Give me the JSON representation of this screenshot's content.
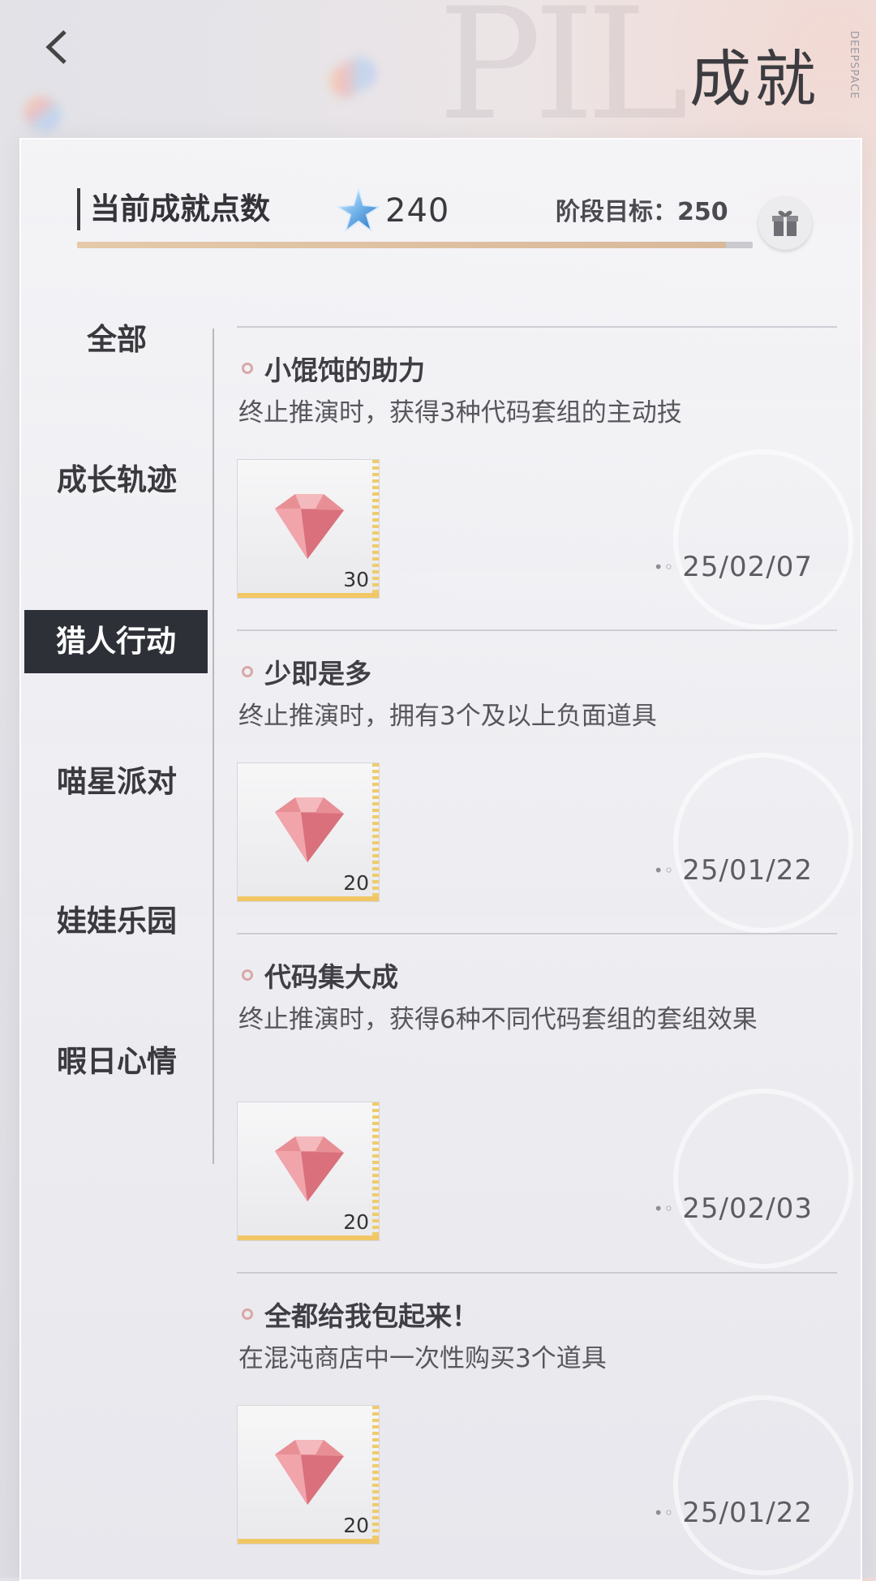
{
  "header": {
    "title": "成就",
    "brand": "DEEPSPACE"
  },
  "points": {
    "label": "当前成就点数",
    "value": "240",
    "goal_label": "阶段目标：250",
    "progress_fraction": 0.96
  },
  "sidebar": {
    "items": [
      {
        "label": "全部"
      },
      {
        "label": "成长轨迹"
      },
      {
        "label": "猎人行动"
      },
      {
        "label": "喵星派对"
      },
      {
        "label": "娃娃乐园"
      },
      {
        "label": "暇日心情"
      }
    ],
    "active_index": 2
  },
  "achievements": [
    {
      "title": "小馄饨的助力",
      "desc": "终止推演时，获得3种代码套组的主动技",
      "reward_qty": "30",
      "date": "25/02/07"
    },
    {
      "title": "少即是多",
      "desc": "终止推演时，拥有3个及以上负面道具",
      "reward_qty": "20",
      "date": "25/01/22"
    },
    {
      "title": "代码集大成",
      "desc": "终止推演时，获得6种不同代码套组的套组效果",
      "reward_qty": "20",
      "date": "25/02/03"
    },
    {
      "title": "全都给我包起来！",
      "desc": "在混沌商店中一次性购买3个道具",
      "reward_qty": "20",
      "date": "25/01/22"
    }
  ],
  "colors": {
    "accent_active": "#2e3038",
    "gem": "#e88f96",
    "reward_strip": "#f1c766"
  }
}
